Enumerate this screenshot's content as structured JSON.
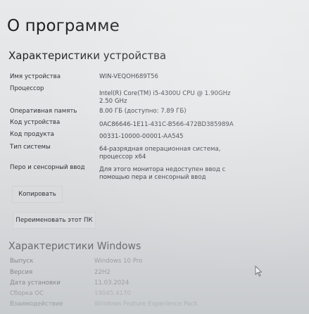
{
  "page_title": "О программе",
  "device_section": {
    "title": "Характеристики устройства",
    "rows": [
      {
        "label": "Имя устройства",
        "value": "WIN-VEQOH689T56"
      },
      {
        "label": "Процессор",
        "value": "Intel(R) Core(TM) i5-4300U CPU @ 1.90GHz",
        "value2": "2.50 GHz"
      },
      {
        "label": "Оперативная память",
        "value": "8.00 ГБ (доступно: 7.89 ГБ)"
      },
      {
        "label": "Код устройства",
        "value": "0AC86646-1E11-431C-B566-472BD385989A"
      },
      {
        "label": "Код продукта",
        "value": "00331-10000-00001-AA545"
      },
      {
        "label": "Тип системы",
        "value": "64-разрядная операционная система,",
        "value2": "процессор x64"
      },
      {
        "label": "Перо и сенсорный ввод",
        "value": "Для этого монитора недоступен ввод с",
        "value2": "помощью пера и сенсорный ввод"
      }
    ],
    "copy_button": "Копировать",
    "rename_button": "Переименовать этот ПК"
  },
  "windows_section": {
    "title": "Характеристики Windows",
    "rows": [
      {
        "label": "Выпуск",
        "value": "Windows 10 Pro"
      },
      {
        "label": "Версия",
        "value": "22H2"
      },
      {
        "label": "Дата установки",
        "value": "11.03.2024"
      },
      {
        "label": "Сборка ОС",
        "value": "19045.4170"
      },
      {
        "label": "Взаимодействие",
        "value": "Windows Feature Experience Pack"
      }
    ]
  },
  "icons": {
    "cursor": "mouse-pointer-icon"
  }
}
